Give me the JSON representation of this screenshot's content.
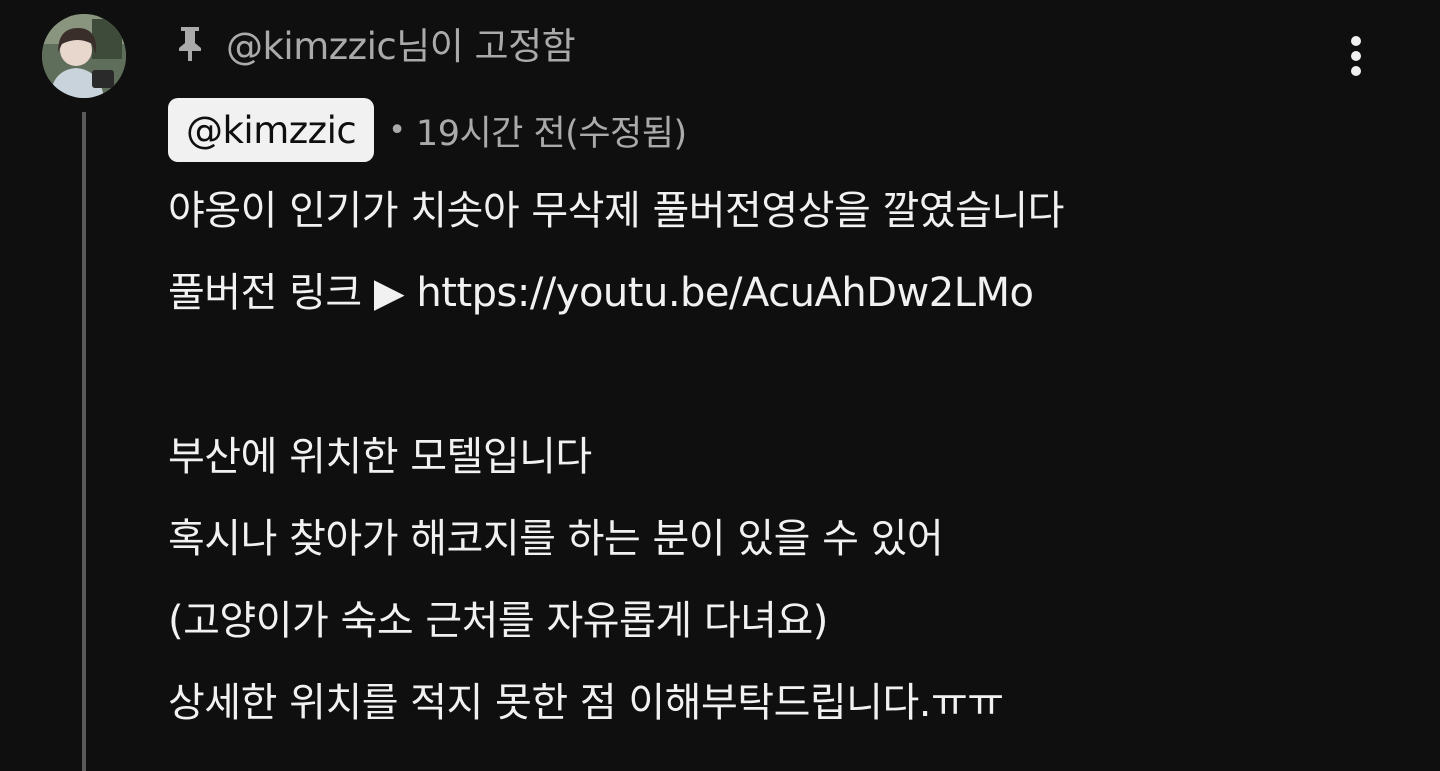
{
  "comment": {
    "pinned_label": "@kimzzic님이 고정함",
    "author": "@kimzzic",
    "meta_separator": "•",
    "timestamp": "19시간 전(수정됨)",
    "line1": "야옹이 인기가 치솟아 무삭제 풀버전영상을 깔였습니다",
    "line2_prefix": "풀버전 링크 ▶ ",
    "line2_link": "https://youtu.be/AcuAhDw2LMo",
    "line3": "부산에 위치한 모텔입니다",
    "line4": "혹시나 찾아가 해코지를 하는 분이 있을 수 있어",
    "line5": "(고양이가 숙소 근처를 자유롭게 다녀요)",
    "line6": "상세한 위치를 적지 못한 점 이해부탁드립니다.ㅠㅠ"
  },
  "icons": {
    "pin": "pin-icon",
    "more": "more-vertical-icon",
    "avatar": "avatar"
  },
  "colors": {
    "background": "#0f0f0f",
    "text_primary": "#f1f1f1",
    "text_secondary": "#aaaaaa",
    "chip_background": "#f1f1f1",
    "thread_line": "#5a5a5a"
  }
}
